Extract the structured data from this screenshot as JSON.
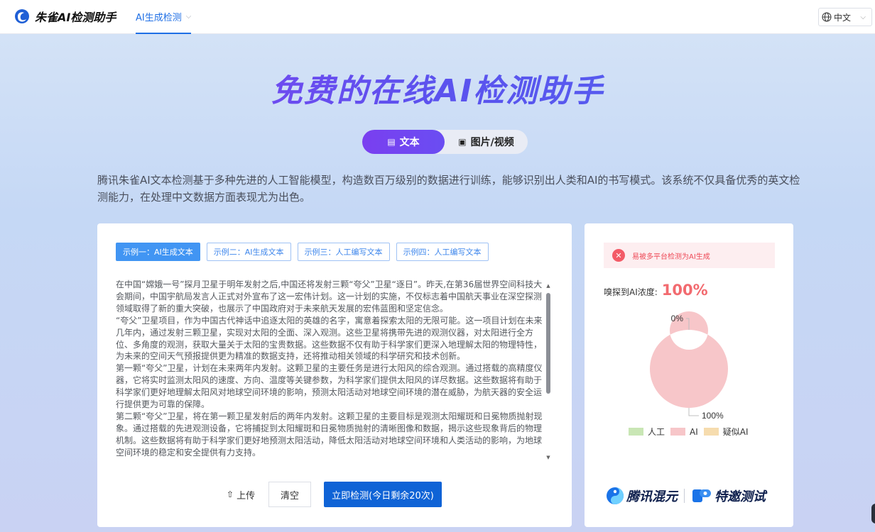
{
  "app": {
    "name": "朱雀AI检测助手"
  },
  "nav": {
    "tab_label": "AI生成检测",
    "language": "中文"
  },
  "hero": {
    "title": "免费的在线AI检测助手",
    "modes": [
      {
        "label": "文本",
        "icon": "document-icon"
      },
      {
        "label": "图片/视频",
        "icon": "image-icon"
      }
    ],
    "intro": "腾讯朱雀AI文本检测基于多种先进的人工智能模型，构造数百万级别的数据进行训练，能够识别出人类和AI的书写模式。该系统不仅具备优秀的英文检测能力，在处理中文数据方面表现尤为出色。"
  },
  "examples": [
    "示例一：AI生成文本",
    "示例二：AI生成文本",
    "示例三：人工编写文本",
    "示例四：人工编写文本"
  ],
  "input_text": [
    "在中国“嫦娥一号”探月卫星于明年发射之后,中国还将发射三颗“夸父”卫星“逐日”。昨天,在第36届世界空间科技大会期间，中国宇航局发言人正式对外宣布了这一宏伟计划。这一计划的实施，不仅标志着中国航天事业在深空探测领域取得了新的重大突破，也展示了中国政府对于未来航天发展的宏伟蓝图和坚定信念。",
    "“夸父”卫星项目，作为中国古代神话中追逐太阳的英雄的名字，寓意着探索太阳的无限可能。这一项目计划在未来几年内，通过发射三颗卫星，实现对太阳的全面、深入观测。这些卫星将携带先进的观测仪器，对太阳进行全方位、多角度的观测，获取大量关于太阳的宝贵数据。这些数据不仅有助于科学家们更深入地理解太阳的物理特性，为未来的空间天气预报提供更为精准的数据支持，还将推动相关领域的科学研究和技术创新。",
    "第一颗“夸父”卫星，计划在未来两年内发射。这颗卫星的主要任务是进行太阳风的综合观测。通过搭载的高精度仪器，它将实时监测太阳风的速度、方向、温度等关键参数，为科学家们提供太阳风的详尽数据。这些数据将有助于科学家们更好地理解太阳风对地球空间环境的影响，预测太阳活动对地球空间环境的潜在威胁，为航天器的安全运行提供更为可靠的保障。",
    "第二颗“夸父”卫星，将在第一颗卫星发射后的两年内发射。这颗卫星的主要目标是观测太阳耀斑和日冕物质抛射现象。通过搭载的先进观测设备，它将捕捉到太阳耀斑和日冕物质抛射的清晰图像和数据，揭示这些现象背后的物理机制。这些数据将有助于科学家们更好地预测太阳活动，降低太阳活动对地球空间环境和人类活动的影响，为地球空间环境的稳定和安全提供有力支持。"
  ],
  "actions": {
    "upload": "上传",
    "clear": "清空",
    "detect": "立即检测(今日剩余20次)"
  },
  "result": {
    "alert": "易被多平台检测为AI生成",
    "concentration_label": "嗅探到AI浓度:",
    "concentration_value": "100%",
    "label_top": "0%",
    "label_bottom": "100%"
  },
  "chart_data": {
    "type": "pie",
    "categories": [
      "人工",
      "AI",
      "疑似AI"
    ],
    "values": [
      0,
      100,
      0
    ],
    "colors": [
      "#c9e6b5",
      "#f7c6c9",
      "#f6dcae"
    ],
    "legend": "bottom"
  },
  "partners": [
    "腾讯混元",
    "特邀测试"
  ],
  "colors": {
    "accent": "#0f63d6",
    "brand_purple": "#7a3ff0",
    "ai_red": "#f26a6f"
  }
}
